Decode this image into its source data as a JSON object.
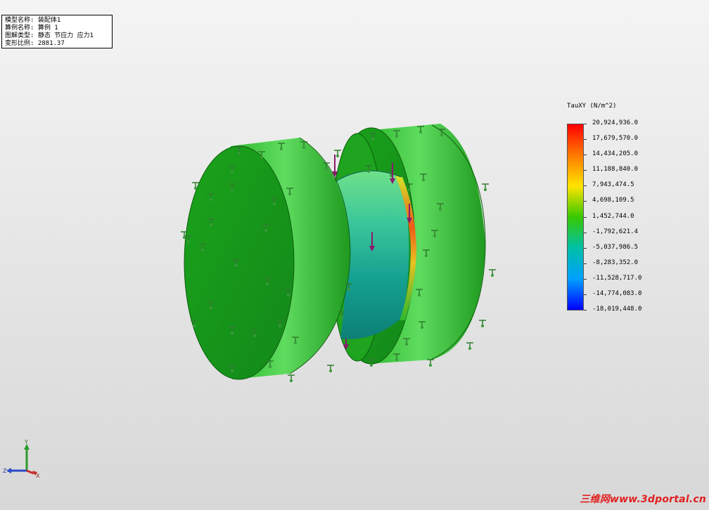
{
  "info_box": {
    "rows": [
      {
        "label": "模型名称:",
        "value": "装配体1"
      },
      {
        "label": "算例名称:",
        "value": "算例 1"
      },
      {
        "label": "图解类型:",
        "value": "静态 节应力 应力1"
      },
      {
        "label": "变形比例:",
        "value": "2881.37"
      }
    ]
  },
  "legend": {
    "title": "TauXY (N/m^2)",
    "ticks": [
      "20,924,936.0",
      "17,679,570.0",
      "14,434,205.0",
      "11,188,840.0",
      "7,943,474.5",
      "4,698,109.5",
      "1,452,744.0",
      "-1,792,621.4",
      "-5,037,986.5",
      "-8,283,352.0",
      "-11,528,717.0",
      "-14,774,083.0",
      "-18,019,448.0"
    ],
    "colors": [
      "#ff0000",
      "#ff7a00",
      "#ffe400",
      "#38c800",
      "#00c0a8",
      "#00a0ff",
      "#0000ff"
    ]
  },
  "triad": {
    "x": "X",
    "y": "Y",
    "z": "Z"
  },
  "watermark": "三维网www.3dportal.cn",
  "colors": {
    "part_green": "#179e17",
    "part_green_light": "#5fdc5f",
    "shaft_teal": "#1aa38f",
    "fixture_green": "#2a8a2a",
    "load_arrow": "#8a1a6e"
  }
}
